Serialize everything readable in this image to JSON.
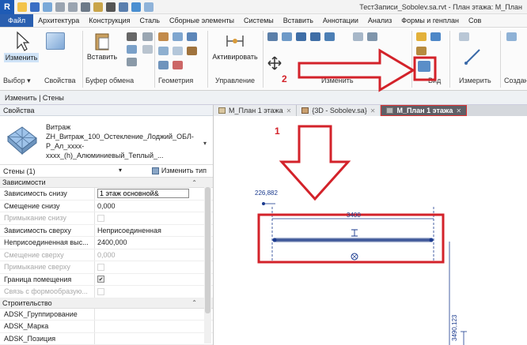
{
  "titlebar": {
    "logo": "R",
    "title": "ТестЗаписи_Sobolev.sa.rvt - План этажа: М_План"
  },
  "menu": {
    "tabs": [
      "Файл",
      "Архитектура",
      "Конструкция",
      "Сталь",
      "Сборные элементы",
      "Системы",
      "Вставить",
      "Аннотации",
      "Анализ",
      "Формы и генплан",
      "Сов"
    ]
  },
  "ribbon": {
    "modify_label": "Изменить",
    "paste_label": "Вставить",
    "activate_label": "Активировать",
    "measure_label": "Измерить",
    "create_label": "Создан",
    "groups": {
      "select": "Выбор",
      "properties": "Свойства",
      "clipboard": "Буфер обмена",
      "geometry": "Геометрия",
      "control": "Управление",
      "modify": "Изменить",
      "view": "Вид",
      "measure": "Измерить"
    }
  },
  "options_bar": {
    "text": "Изменить | Стены"
  },
  "properties": {
    "header": "Свойства",
    "type_name": "Витраж",
    "type_detail": "ZH_Витраж_100_Остекление_Лоджий_ОБЛ-Р_Ал_xxxx-xxxx_(h)_Алюминиевый_Теплый_...",
    "filter": "Стены (1)",
    "edit_type": "Изменить тип",
    "categories": {
      "constraints": "Зависимости",
      "construction": "Строительство"
    },
    "rows": [
      {
        "name": "Зависимость снизу",
        "value": "1 этаж основной&",
        "kind": "input"
      },
      {
        "name": "Смещение снизу",
        "value": "0,000",
        "kind": "text"
      },
      {
        "name": "Примыкание снизу",
        "value": "",
        "kind": "check-disabled"
      },
      {
        "name": "Зависимость сверху",
        "value": "Неприсоединенная",
        "kind": "text"
      },
      {
        "name": "Неприсоединенная выс...",
        "value": "2400,000",
        "kind": "text"
      },
      {
        "name": "Смещение сверху",
        "value": "0,000",
        "kind": "text-disabled"
      },
      {
        "name": "Примыкание сверху",
        "value": "",
        "kind": "check-disabled"
      },
      {
        "name": "Граница помещения",
        "value": "✔",
        "kind": "check-on"
      },
      {
        "name": "Связь с формообразую...",
        "value": "",
        "kind": "check-disabled"
      }
    ],
    "construction_rows": [
      {
        "name": "ADSK_Группирование",
        "value": ""
      },
      {
        "name": "ADSK_Марка",
        "value": ""
      },
      {
        "name": "ADSK_Позиция",
        "value": ""
      }
    ]
  },
  "doc_tabs": [
    {
      "label": "М_План 1 этажа",
      "active": false
    },
    {
      "label": "{3D - Sobolev.sa}",
      "active": false
    },
    {
      "label": "М_План 1 этажа",
      "active": true
    }
  ],
  "canvas": {
    "dim_left": "226,882",
    "dim_top": "3400",
    "dim_vertical": "3490,123",
    "annotation_1": "1",
    "annotation_2": "2"
  },
  "colors": {
    "accent": "#2a5fb0",
    "highlight_red": "#d3222a",
    "wall_blue": "#1b3b8f"
  }
}
